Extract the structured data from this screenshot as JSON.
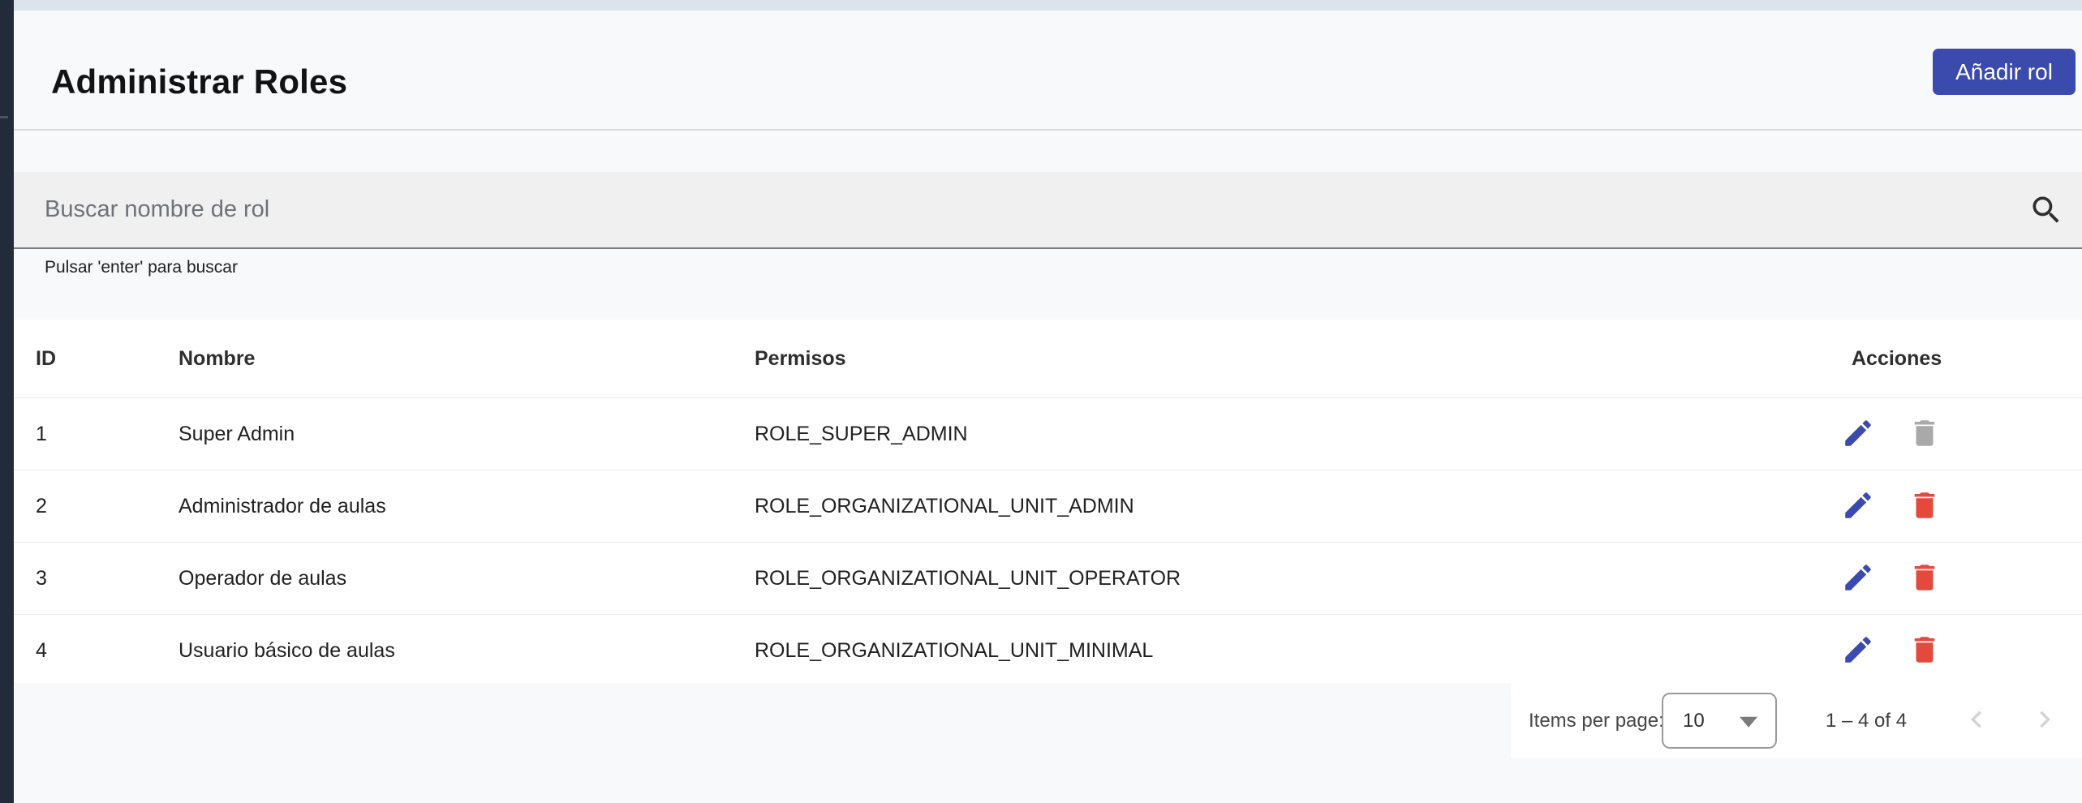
{
  "app": {
    "title": "Administrar Roles"
  },
  "header": {
    "add_role_button": "Añadir rol"
  },
  "search": {
    "placeholder": "Buscar nombre de rol",
    "hint": "Pulsar 'enter' para buscar"
  },
  "table": {
    "columns": {
      "id": "ID",
      "name": "Nombre",
      "permissions": "Permisos",
      "actions": "Acciones"
    },
    "rows": [
      {
        "id": "1",
        "name": "Super Admin",
        "permissions": "ROLE_SUPER_ADMIN",
        "delete_disabled": true
      },
      {
        "id": "2",
        "name": "Administrador de aulas",
        "permissions": "ROLE_ORGANIZATIONAL_UNIT_ADMIN",
        "delete_disabled": false
      },
      {
        "id": "3",
        "name": "Operador de aulas",
        "permissions": "ROLE_ORGANIZATIONAL_UNIT_OPERATOR",
        "delete_disabled": false
      },
      {
        "id": "4",
        "name": "Usuario básico de aulas",
        "permissions": "ROLE_ORGANIZATIONAL_UNIT_MINIMAL",
        "delete_disabled": false
      }
    ]
  },
  "paginator": {
    "items_per_page_label": "Items per page:",
    "page_size": "10",
    "range_label": "1 – 4 of 4"
  },
  "icons": {
    "search": "search-icon",
    "edit": "pencil-edit-icon",
    "delete": "trash-icon",
    "page_size_caret": "caret-down-icon",
    "previous_page": "chevron-left-icon",
    "next_page": "chevron-right-icon"
  },
  "colors": {
    "primary_indigo": "#3b4aad",
    "danger_red": "#e5493c",
    "disabled_gray": "#a9a9a9",
    "sidebar_dark": "#222b3a",
    "top_strip_blue_gray": "#dce3ed",
    "page_background": "#f8f9fa",
    "search_field_fill": "#f0f0f1"
  }
}
